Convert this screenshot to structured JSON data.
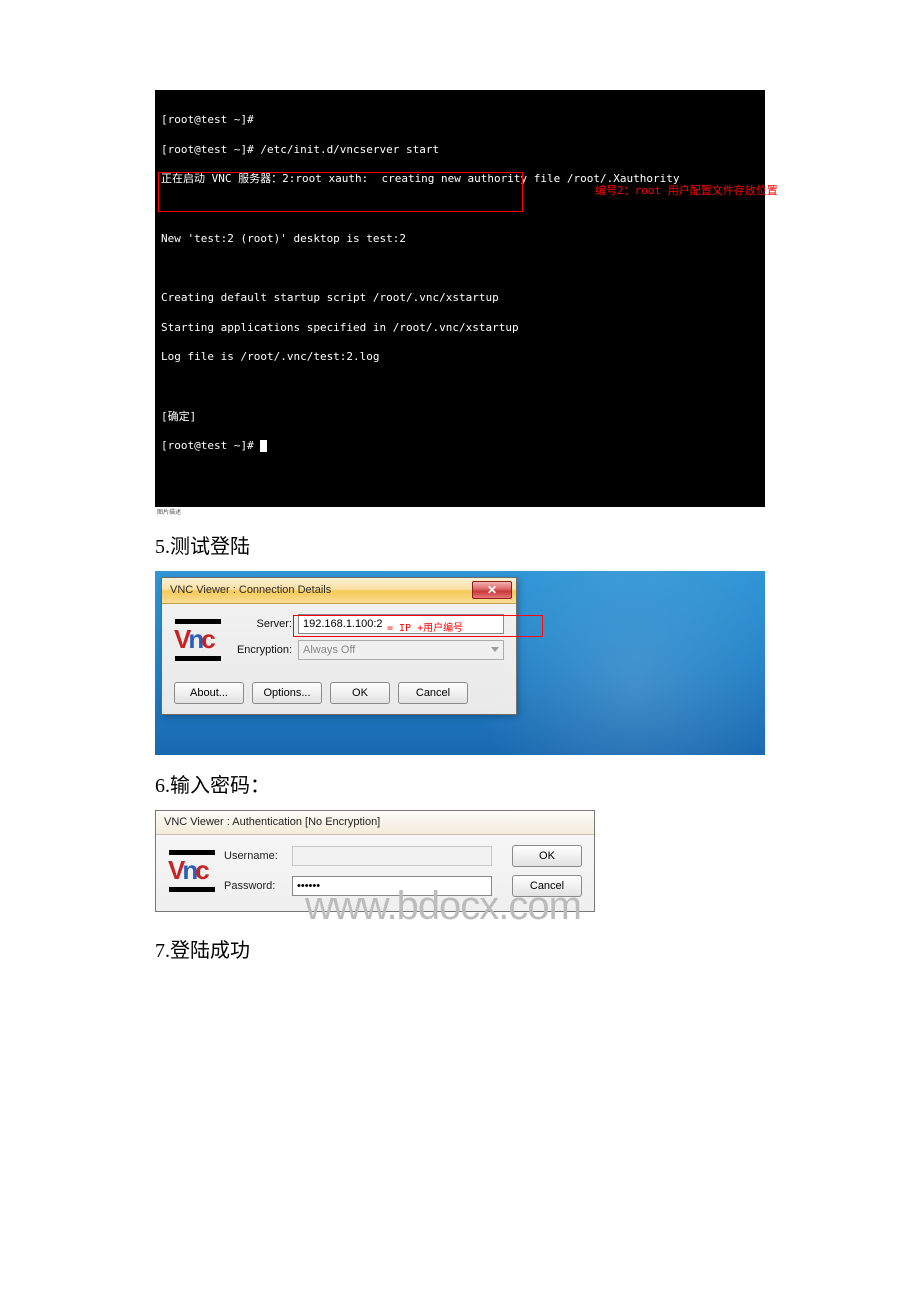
{
  "terminal": {
    "lines": [
      "[root@test ~]#",
      "[root@test ~]# /etc/init.d/vncserver start",
      "正在启动 VNC 服务器：2:root xauth:  creating new authority file /root/.Xauthority",
      "",
      "New 'test:2 (root)' desktop is test:2",
      "",
      "Creating default startup script /root/.vnc/xstartup",
      "Starting applications specified in /root/.vnc/xstartup",
      "Log file is /root/.vnc/test:2.log",
      "",
      "[确定]",
      "[root@test ~]# "
    ],
    "note": "编号2：root 用户配置文件存放位置"
  },
  "small_caption": "图片描述",
  "step5": "5.测试登陆",
  "vnc_conn": {
    "title": "VNC Viewer : Connection Details",
    "server_label": "Server:",
    "server_value": "192.168.1.100:2",
    "encryption_label": "Encryption:",
    "encryption_value": "Always Off",
    "about": "About...",
    "options": "Options...",
    "ok": "OK",
    "cancel": "Cancel",
    "red_note": "= IP +用户编号",
    "close": "✕"
  },
  "step6": "6.输入密码：",
  "vnc_auth": {
    "title": "VNC Viewer : Authentication [No Encryption]",
    "username_label": "Username:",
    "password_label": "Password:",
    "password_value": "••••••",
    "ok": "OK",
    "cancel": "Cancel"
  },
  "watermark": "www.bdocx.com",
  "step7": "7.登陆成功"
}
